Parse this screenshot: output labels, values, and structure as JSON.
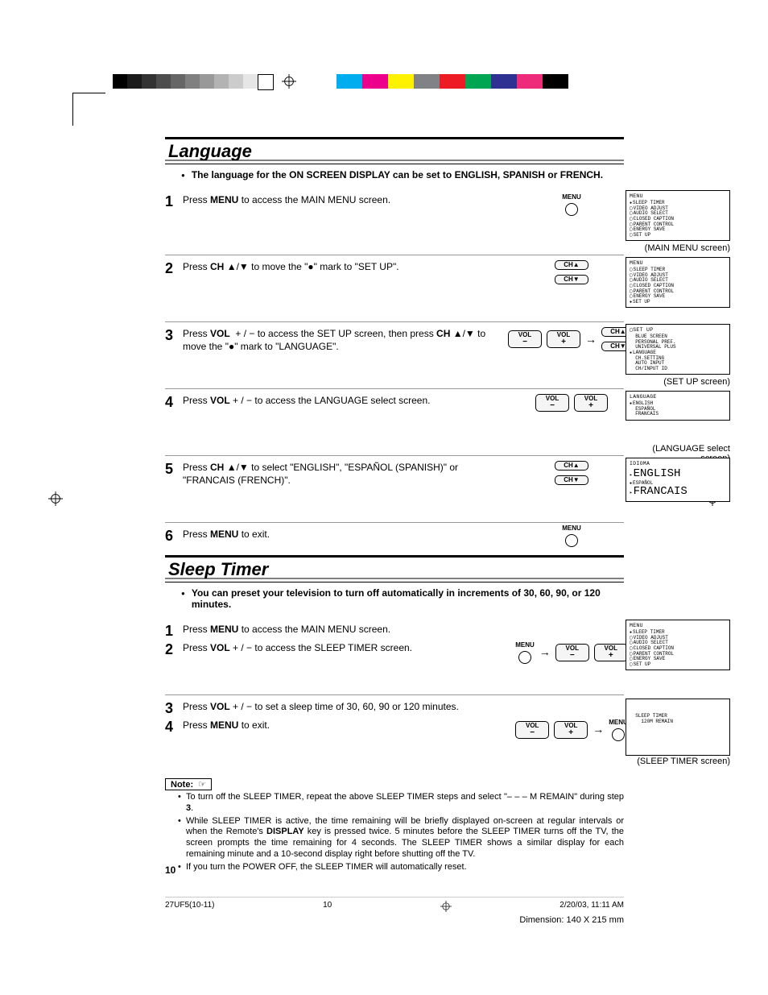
{
  "printer_marks": {
    "grays": [
      "#000000",
      "#1a1a1a",
      "#333333",
      "#4d4d4d",
      "#666666",
      "#808080",
      "#999999",
      "#b3b3b3",
      "#cccccc",
      "#e6e6e6",
      "#ffffff"
    ],
    "colors": [
      "#00aeef",
      "#ec008c",
      "#fff200",
      "#808285",
      "#ed1c24",
      "#00a651",
      "#2e3192",
      "#ee2a7b",
      "#000000"
    ]
  },
  "section1": {
    "title": "Language",
    "intro": "The language for the ON SCREEN DISPLAY can be set to ENGLISH, SPANISH or FRENCH.",
    "steps": [
      {
        "num": "1",
        "text_pre": "Press ",
        "text_b1": "MENU",
        "text_post": " to access the MAIN MENU screen.",
        "controls": "menu",
        "screen": {
          "title": "MENU",
          "items": [
            {
              "style": "sel",
              "t": "SLEEP TIMER"
            },
            {
              "style": "box",
              "t": "VIDEO ADJUST"
            },
            {
              "style": "box",
              "t": "AUDIO SELECT"
            },
            {
              "style": "box",
              "t": "CLOSED CAPTION"
            },
            {
              "style": "box",
              "t": "PARENT CONTROL"
            },
            {
              "style": "box",
              "t": "ENERGY SAVE"
            },
            {
              "style": "box",
              "t": "SET UP"
            }
          ],
          "caption": "(MAIN MENU screen)"
        }
      },
      {
        "num": "2",
        "text_full": "Press <b>CH</b> ▲/▼ to move the \"●\" mark to \"SET UP\".",
        "controls": "ch",
        "screen": {
          "title": "MENU",
          "items": [
            {
              "style": "box",
              "t": "SLEEP TIMER"
            },
            {
              "style": "box",
              "t": "VIDEO ADJUST"
            },
            {
              "style": "box",
              "t": "AUDIO SELECT"
            },
            {
              "style": "box",
              "t": "CLOSED CAPTION"
            },
            {
              "style": "box",
              "t": "PARENT CONTROL"
            },
            {
              "style": "box",
              "t": "ENERGY SAVE"
            },
            {
              "style": "sel",
              "t": "SET UP"
            }
          ]
        }
      },
      {
        "num": "3",
        "text_full": "Press <b>VOL</b> &nbsp;+ / − to access the SET UP screen, then press <b>CH</b> ▲/▼ to move the \"●\" mark to \"LANGUAGE\".",
        "controls": "vol-ch",
        "screen": {
          "title": "▢SET UP",
          "items": [
            {
              "style": "plain",
              "t": "BLUE SCREEN"
            },
            {
              "style": "plain",
              "t": "PERSONAL PREF."
            },
            {
              "style": "plain",
              "t": "UNIVERSAL PLUS"
            },
            {
              "style": "sel",
              "t": "LANGUAGE"
            },
            {
              "style": "plain",
              "t": "CH.SETTING"
            },
            {
              "style": "plain",
              "t": "AUTO INPUT"
            },
            {
              "style": "plain",
              "t": "CH/INPUT ID"
            }
          ],
          "caption": "(SET UP screen)"
        }
      },
      {
        "num": "4",
        "text_full": "Press <b>VOL</b> + / − to access the LANGUAGE select screen.",
        "controls": "vol",
        "screen": {
          "title": "LANGUAGE",
          "items": [
            {
              "style": "sel",
              "t": "ENGLISH"
            },
            {
              "style": "plain",
              "t": "ESPAÑOL"
            },
            {
              "style": "plain",
              "t": "FRANCAIS"
            }
          ],
          "caption": "(LANGUAGE select screen)"
        }
      },
      {
        "num": "5",
        "text_full": "Press <b>CH</b> ▲/▼ to select \"ENGLISH\", \"ESPAÑOL (SPANISH)\" or \"FRANCAIS (FRENCH)\".",
        "controls": "ch",
        "screen": {
          "title": "IDIOMA",
          "items": [
            {
              "style": "arrow",
              "t": "ENGLISH"
            },
            {
              "style": "sel",
              "t": "ESPAÑOL"
            },
            {
              "style": "arrow",
              "t": "FRANCAIS"
            }
          ]
        }
      },
      {
        "num": "6",
        "text_full": "Press <b>MENU</b> to exit.",
        "controls": "menu",
        "short": true
      }
    ]
  },
  "section2": {
    "title": "Sleep Timer",
    "intro": "You can preset your television to turn off automatically in increments of 30, 60, 90, or 120 minutes.",
    "steps12": {
      "s1_num": "1",
      "s1_text": "Press <b>MENU</b> to access the MAIN MENU screen.",
      "s2_num": "2",
      "s2_text": "Press <b>VOL</b> + / − to access the SLEEP TIMER screen.",
      "controls": "menu-vol",
      "screen": {
        "title": "MENU",
        "items": [
          {
            "style": "sel",
            "t": "SLEEP TIMER"
          },
          {
            "style": "box",
            "t": "VIDEO ADJUST"
          },
          {
            "style": "box",
            "t": "AUDIO SELECT"
          },
          {
            "style": "box",
            "t": "CLOSED CAPTION"
          },
          {
            "style": "box",
            "t": "PARENT CONTROL"
          },
          {
            "style": "box",
            "t": "ENERGY SAVE"
          },
          {
            "style": "box",
            "t": "SET UP"
          }
        ]
      }
    },
    "steps34": {
      "s3_num": "3",
      "s3_text": "Press <b>VOL</b> + / − to set a sleep time of 30, 60, 90 or 120 minutes.",
      "s4_num": "4",
      "s4_text": "Press <b>MENU</b> to exit.",
      "controls": "vol-menu",
      "screen": {
        "title": "",
        "items": [
          {
            "style": "plain",
            "t": "SLEEP TIMER"
          },
          {
            "style": "plain",
            "t": "  120M REMAIN"
          }
        ],
        "caption": "(SLEEP TIMER screen)"
      }
    },
    "note_label": "Note:",
    "notes": [
      "To turn off the SLEEP TIMER, repeat the above SLEEP TIMER steps and select \"– – – M REMAIN\" during step <b>3</b>.",
      "While SLEEP TIMER is active, the time remaining will be briefly displayed on-screen at regular intervals or when the Remote's <b>DISPLAY</b> key is pressed twice. 5 minutes before the SLEEP TIMER turns off the TV, the screen prompts the time remaining for 4 seconds. The SLEEP TIMER shows a similar display for each remaining minute and a 10-second display right before shutting off the TV.",
      "If you turn the POWER OFF, the SLEEP TIMER will automatically reset."
    ]
  },
  "page_number": "10",
  "footer": {
    "file": "27UF5(10-11)",
    "page": "10",
    "date": "2/20/03, 11:11 AM",
    "dimension": "Dimension: 140  X 215 mm"
  },
  "btn_labels": {
    "menu": "MENU",
    "ch_up": "CH▲",
    "ch_dn": "CH▼",
    "vol_m": "VOL",
    "vol_minus": "−",
    "vol_plus": "+"
  }
}
